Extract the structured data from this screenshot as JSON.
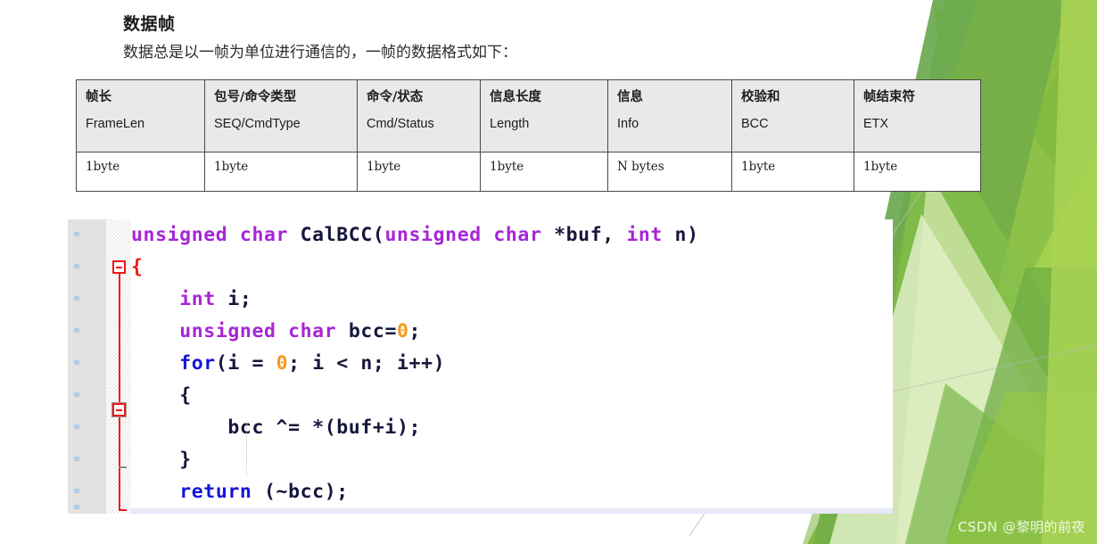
{
  "slide": {
    "title": "数据帧",
    "subtitle": "数据总是以一帧为单位进行通信的，一帧的数据格式如下："
  },
  "frame_table": {
    "columns": [
      {
        "cn": "帧长",
        "en": "FrameLen",
        "size": "1byte"
      },
      {
        "cn": "包号/命令类型",
        "en": "SEQ/CmdType",
        "size": "1byte"
      },
      {
        "cn": "命令/状态",
        "en": "Cmd/Status",
        "size": "1byte"
      },
      {
        "cn": "信息长度",
        "en": "Length",
        "size": "1byte"
      },
      {
        "cn": "信息",
        "en": "Info",
        "size": "N bytes"
      },
      {
        "cn": "校验和",
        "en": "BCC",
        "size": "1byte"
      },
      {
        "cn": "帧结束符",
        "en": "ETX",
        "size": "1byte"
      }
    ]
  },
  "code": {
    "language": "c",
    "lines": [
      {
        "text": "unsigned char CalBCC(unsigned char *buf, int n)",
        "tokens": [
          {
            "t": "unsigned char ",
            "c": "kw-type"
          },
          {
            "t": "CalBCC",
            "c": "plain"
          },
          {
            "t": "(",
            "c": "plain"
          },
          {
            "t": "unsigned char ",
            "c": "kw-type"
          },
          {
            "t": "*buf",
            "c": "plain"
          },
          {
            "t": ", ",
            "c": "plain"
          },
          {
            "t": "int ",
            "c": "kw-type"
          },
          {
            "t": "n",
            "c": "plain"
          },
          {
            "t": ")",
            "c": "plain"
          }
        ]
      },
      {
        "text": "{",
        "tokens": [
          {
            "t": "{",
            "c": "brace"
          }
        ]
      },
      {
        "text": "    int i;",
        "tokens": [
          {
            "t": "    ",
            "c": "plain"
          },
          {
            "t": "int ",
            "c": "kw-type"
          },
          {
            "t": "i;",
            "c": "plain"
          }
        ]
      },
      {
        "text": "    unsigned char bcc=0;",
        "tokens": [
          {
            "t": "    ",
            "c": "plain"
          },
          {
            "t": "unsigned char ",
            "c": "kw-type"
          },
          {
            "t": "bcc=",
            "c": "plain"
          },
          {
            "t": "0",
            "c": "num"
          },
          {
            "t": ";",
            "c": "plain"
          }
        ]
      },
      {
        "text": "    for(i = 0; i < n; i++)",
        "tokens": [
          {
            "t": "    ",
            "c": "plain"
          },
          {
            "t": "for",
            "c": "kw-ctrl"
          },
          {
            "t": "(i = ",
            "c": "plain"
          },
          {
            "t": "0",
            "c": "num"
          },
          {
            "t": "; i < n; i++)",
            "c": "plain"
          }
        ]
      },
      {
        "text": "    {",
        "tokens": [
          {
            "t": "    ",
            "c": "plain"
          },
          {
            "t": "{",
            "c": "plain"
          }
        ]
      },
      {
        "text": "        bcc ^= *(buf+i);",
        "tokens": [
          {
            "t": "        bcc ^= *(buf+i);",
            "c": "plain"
          }
        ]
      },
      {
        "text": "    }",
        "tokens": [
          {
            "t": "    ",
            "c": "plain"
          },
          {
            "t": "}",
            "c": "plain"
          }
        ]
      },
      {
        "text": "    return (~bcc);",
        "tokens": [
          {
            "t": "    ",
            "c": "plain"
          },
          {
            "t": "return",
            "c": "kw-ctrl"
          },
          {
            "t": " (~bcc);",
            "c": "plain"
          }
        ]
      },
      {
        "text": "}",
        "tokens": [
          {
            "t": "}",
            "c": "brace"
          }
        ],
        "current": true
      }
    ]
  },
  "watermark": {
    "text": "CSDN @黎明的前夜"
  },
  "colors": {
    "type_keyword": "#a626d6",
    "control_keyword": "#1414d8",
    "number_literal": "#f59b1c",
    "brace": "#f01818",
    "identifier": "#16163c",
    "current_line": "#e7e7f8",
    "table_header_bg": "#e9e9e9",
    "gutter_bg": "#e2e2e2",
    "deco_green_dark": "#6aa84f",
    "deco_green_mid": "#8cc152",
    "deco_green_light": "#a8d05a",
    "deco_green_pale": "#d7e8b8"
  }
}
